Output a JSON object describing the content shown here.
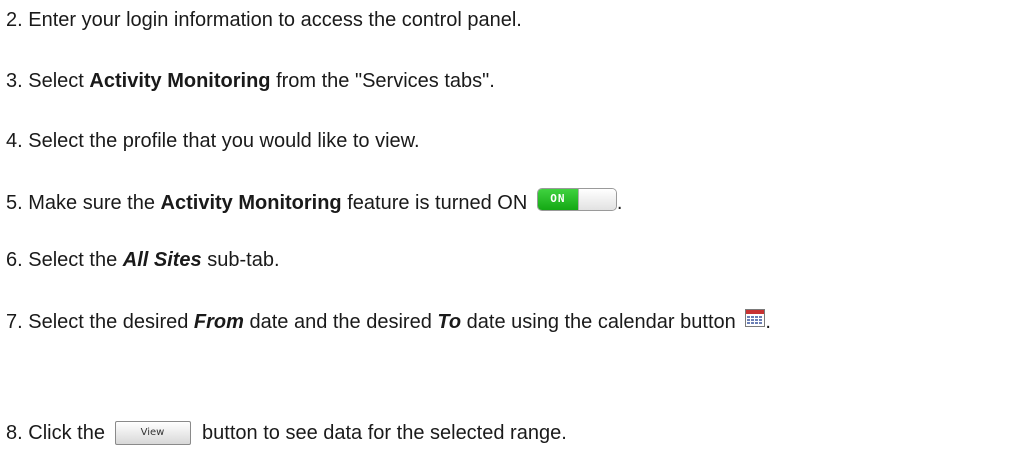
{
  "steps": [
    {
      "number": "2.",
      "text": "Enter your login information to access the control panel."
    },
    {
      "number": "3.",
      "pre": "Select ",
      "bold": "Activity Monitoring",
      "post": " from the \"Services tabs\"."
    },
    {
      "number": "4.",
      "text": "Select the profile that you would like to view."
    },
    {
      "number": "5.",
      "pre": "Make sure the ",
      "bold": "Activity Monitoring",
      "post": " feature is turned ON ",
      "toggle_label": "ON",
      "end": "."
    },
    {
      "number": "6.",
      "pre": "Select the ",
      "bold_italic": "All Sites",
      "post": " sub-tab."
    },
    {
      "number": "7.",
      "pre": "Select the desired ",
      "bold_italic_1": "From",
      "mid": " date and the desired ",
      "bold_italic_2": "To",
      "post": " date using the calendar button ",
      "end": "."
    },
    {
      "number": "8.",
      "pre": "Click the ",
      "button_label": "View",
      "post": " button to see data for the selected range."
    }
  ],
  "icons": {
    "toggle": "toggle-switch-on-icon",
    "calendar": "calendar-icon"
  },
  "colors": {
    "toggle_on": "#14a814",
    "text": "#1a1a1a"
  }
}
